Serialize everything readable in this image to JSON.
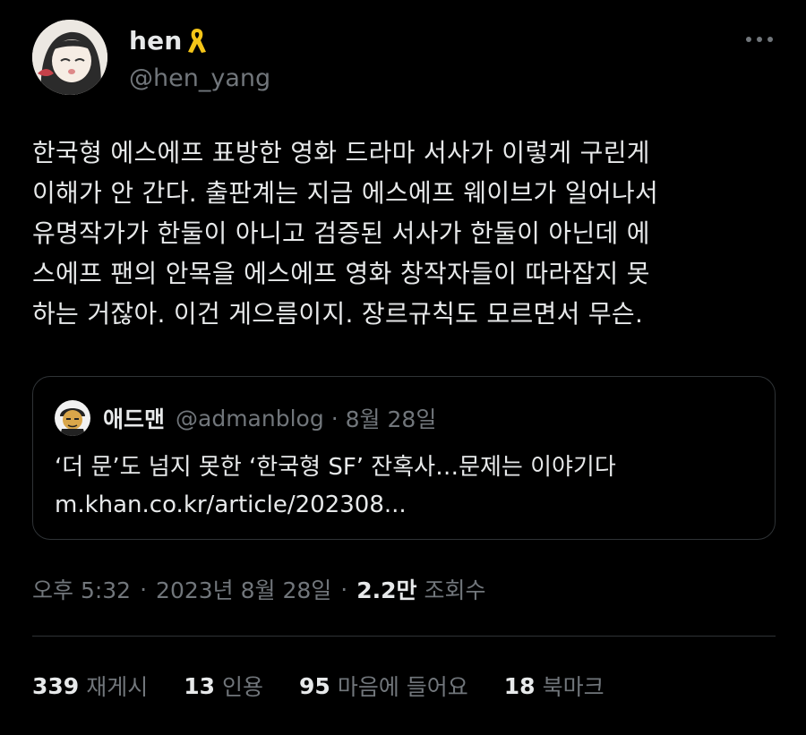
{
  "author": {
    "display_name": "hen",
    "handle": "@hen_yang",
    "badge_icon": "yellow-ribbon-icon"
  },
  "tweet": {
    "text": "한국형 에스에프 표방한 영화 드라마 서사가 이렇게 구린게\n이해가 안 간다. 출판계는 지금 에스에프 웨이브가 일어나서\n유명작가가 한둘이 아니고 검증된 서사가 한둘이 아닌데 에\n스에프 팬의 안목을 에스에프 영화 창작자들이 따라잡지 못\n하는 거잖아. 이건 게으름이지. 장르규칙도 모르면서 무슨."
  },
  "quote": {
    "name": "애드맨",
    "handle": "@admanblog",
    "dot": "·",
    "date": "8월 28일",
    "text": "‘더 문’도 넘지 못한 ‘한국형 SF’ 잔혹사…문제는 이야기다\nm.khan.co.kr/article/202308..."
  },
  "meta": {
    "time": "오후 5:32",
    "sep1": "·",
    "date": "2023년 8월 28일",
    "sep2": "·",
    "views": "2.2만",
    "views_label": "조회수"
  },
  "stats": [
    {
      "num": "339",
      "label": "재게시"
    },
    {
      "num": "13",
      "label": "인용"
    },
    {
      "num": "95",
      "label": "마음에 들어요"
    },
    {
      "num": "18",
      "label": "북마크"
    }
  ],
  "colors": {
    "background": "#000000",
    "text_primary": "#e7e9ea",
    "text_secondary": "#71767b",
    "border": "#2f3336",
    "ribbon": "#f5c518"
  }
}
